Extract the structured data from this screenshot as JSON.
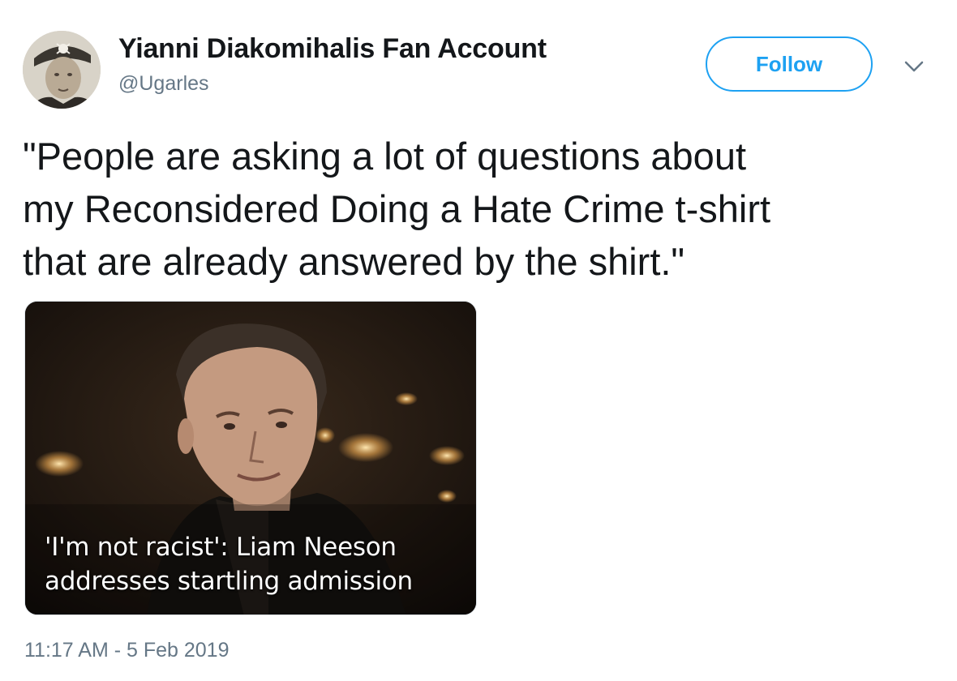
{
  "tweet": {
    "author": {
      "display_name": "Yianni Diakomihalis Fan Account",
      "handle": "@Ugarles",
      "avatar_icon": "skull-crossbones-badge"
    },
    "follow_label": "Follow",
    "more_icon": "chevron-down-icon",
    "text_lines": [
      "\"People are asking a lot of questions about",
      "my Reconsidered Doing a Hate Crime t-shirt",
      "that are already answered by the shirt.\""
    ],
    "media": {
      "caption_lines": [
        "'I'm not racist': Liam Neeson",
        "addresses startling admission"
      ]
    },
    "timestamp": "11:17 AM - 5 Feb 2019"
  },
  "colors": {
    "accent": "#1da1f2",
    "text_primary": "#14171a",
    "text_secondary": "#657786"
  }
}
